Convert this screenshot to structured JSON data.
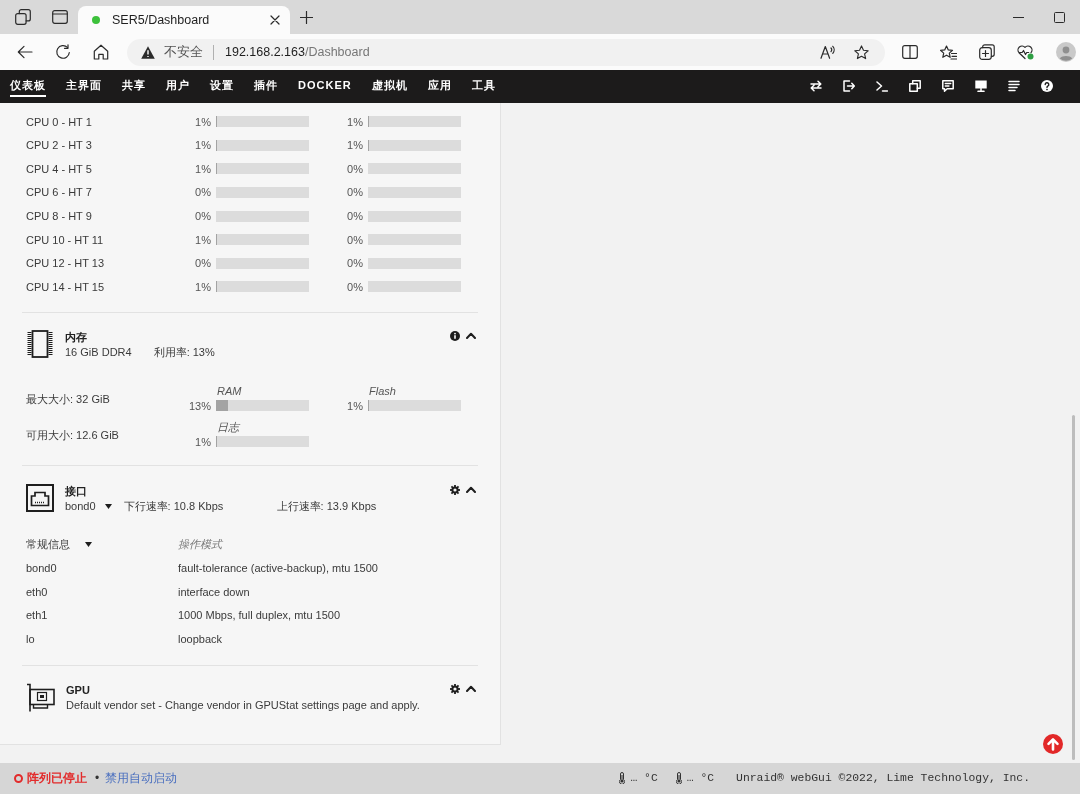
{
  "browser": {
    "tab_title": "SER5/Dashboard",
    "security_label": "不安全",
    "url_host": "192.168.2.163",
    "url_path": "/Dashboard"
  },
  "nav": {
    "tabs": [
      {
        "label": "仪表板",
        "selected": true
      },
      {
        "label": "主界面",
        "selected": false
      },
      {
        "label": "共享",
        "selected": false
      },
      {
        "label": "用户",
        "selected": false
      },
      {
        "label": "设置",
        "selected": false
      },
      {
        "label": "插件",
        "selected": false
      },
      {
        "label": "DOCKER",
        "selected": false
      },
      {
        "label": "虚拟机",
        "selected": false
      },
      {
        "label": "应用",
        "selected": false
      },
      {
        "label": "工具",
        "selected": false
      }
    ]
  },
  "cpu": {
    "rows": [
      {
        "label": "CPU 0 - HT 1",
        "threads": [
          {
            "reading": "1%",
            "level": 0.01
          },
          {
            "reading": "1%",
            "level": 0.01
          }
        ]
      },
      {
        "label": "CPU 2 - HT 3",
        "threads": [
          {
            "reading": "1%",
            "level": 0.01
          },
          {
            "reading": "1%",
            "level": 0.01
          }
        ]
      },
      {
        "label": "CPU 4 - HT 5",
        "threads": [
          {
            "reading": "1%",
            "level": 0.01
          },
          {
            "reading": "0%",
            "level": 0
          }
        ]
      },
      {
        "label": "CPU 6 - HT 7",
        "threads": [
          {
            "reading": "0%",
            "level": 0
          },
          {
            "reading": "0%",
            "level": 0
          }
        ]
      },
      {
        "label": "CPU 8 - HT 9",
        "threads": [
          {
            "reading": "0%",
            "level": 0
          },
          {
            "reading": "0%",
            "level": 0
          }
        ]
      },
      {
        "label": "CPU 10 - HT 11",
        "threads": [
          {
            "reading": "1%",
            "level": 0.01
          },
          {
            "reading": "0%",
            "level": 0
          }
        ]
      },
      {
        "label": "CPU 12 - HT 13",
        "threads": [
          {
            "reading": "0%",
            "level": 0
          },
          {
            "reading": "0%",
            "level": 0
          }
        ]
      },
      {
        "label": "CPU 14 - HT 15",
        "threads": [
          {
            "reading": "1%",
            "level": 0.01
          },
          {
            "reading": "0%",
            "level": 0
          }
        ]
      }
    ]
  },
  "memory": {
    "title": "内存",
    "expanded": true,
    "module": "16 GiB DDR4",
    "usage": "利用率: 13%",
    "sizes": [
      "最大大小: 32 GiB",
      "可用大小: 12.6 GiB"
    ],
    "meters": [
      {
        "label": "RAM",
        "reading": "13%",
        "level": 0.13
      },
      {
        "label": "Flash",
        "reading": "1%",
        "level": 0.01
      },
      {
        "label": "日志",
        "reading": "1%",
        "level": 0.01
      }
    ]
  },
  "network": {
    "title": "接口",
    "expanded": true,
    "port": "bond0",
    "download": "下行速率: 10.8 Kbps",
    "upload": "上行速率: 13.9 Kbps",
    "view": "常规信息",
    "column_header": "操作模式",
    "rows": [
      {
        "name": "bond0",
        "mode": "fault-tolerance (active-backup), mtu 1500"
      },
      {
        "name": "eth0",
        "mode": "interface down"
      },
      {
        "name": "eth1",
        "mode": "1000 Mbps, full duplex, mtu 1500"
      },
      {
        "name": "lo",
        "mode": "loopback"
      }
    ]
  },
  "gpu": {
    "title": "GPU",
    "expanded": true,
    "message": "Default vendor set - Change vendor in GPUStat settings page and apply."
  },
  "status_bar": {
    "array_status": "阵列已停止",
    "separator": "•",
    "autostart": "禁用自动启动",
    "temperatures": [
      "… °C",
      "… °C"
    ],
    "copyright": "Unraid® webGui ©2022, Lime Technology, Inc."
  }
}
